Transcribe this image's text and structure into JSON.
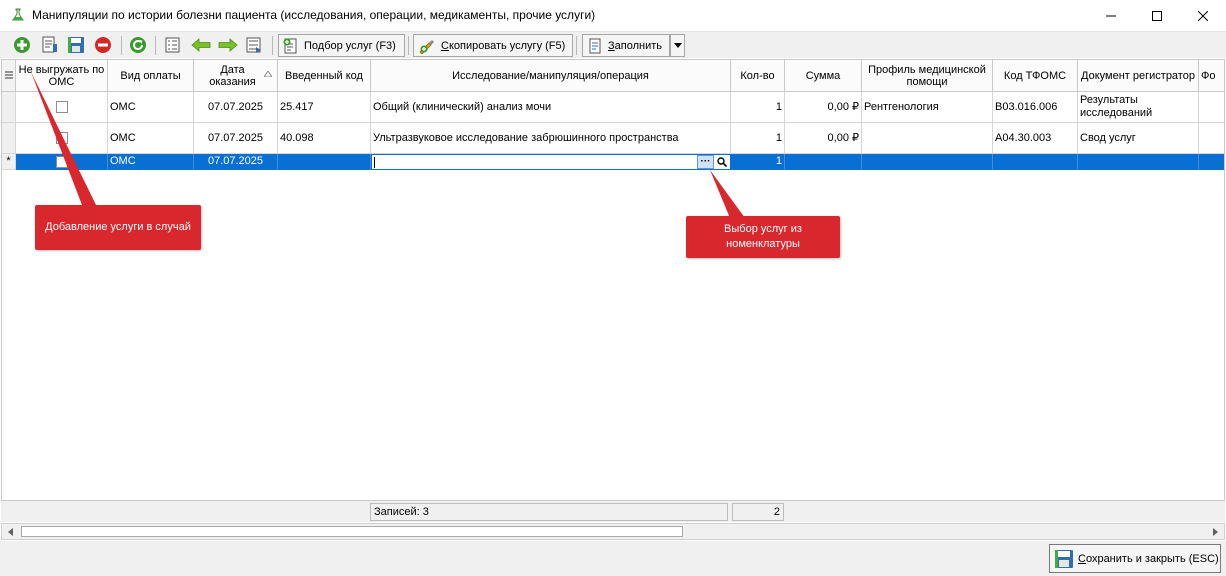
{
  "window": {
    "title": "Манипуляции по истории болезни пациента (исследования, операции, медикаменты, прочие услуги)",
    "minimize_icon": "minimize-icon",
    "maximize_icon": "maximize-icon",
    "close_icon": "close-icon"
  },
  "toolbar": {
    "icons": [
      "add-icon",
      "document-icon",
      "save-icon",
      "delete-icon",
      "refresh-icon",
      "list-icon",
      "arrow-left-icon",
      "arrow-right-icon",
      "list-move-icon"
    ],
    "select_services_label": "Подбор услуг (F3)",
    "copy_service_prefix": "С",
    "copy_service_label": "копировать услугу (F5)",
    "fill_prefix": "З",
    "fill_label": "аполнить",
    "accent_green": "#3a9a2e",
    "accent_red": "#d22828"
  },
  "grid": {
    "columns": [
      "Не выгружать по ОМС",
      "Вид оплаты",
      "Дата оказания",
      "Введенный код",
      "Исследование/манипуляция/операция",
      "Кол-во",
      "Сумма",
      "Профиль медицинской помощи",
      "Код ТФОМС",
      "Документ регистратор",
      "Фо"
    ],
    "rows": [
      {
        "not_upload": "",
        "payment": "ОМС",
        "date": "07.07.2025",
        "entered_code": "25.417",
        "service": "Общий (клинический) анализ мочи",
        "qty": "1",
        "sum": "0,00 ₽",
        "profile": "Рентгенология",
        "tfoms_code": "B03.016.006",
        "document": "Результаты исследований"
      },
      {
        "not_upload": "",
        "payment": "ОМС",
        "date": "07.07.2025",
        "entered_code": "40.098",
        "service": "Ультразвуковое исследование забрюшинного пространства",
        "qty": "1",
        "sum": "0,00 ₽",
        "profile": "",
        "tfoms_code": "A04.30.003",
        "document": "Свод услуг"
      }
    ],
    "new_row": {
      "indicator": "*",
      "payment": "ОМС",
      "date": "07.07.2025",
      "ellipsis": "···",
      "qty": "1"
    },
    "selection_color": "#0a6fd3"
  },
  "status": {
    "records": "Записей: 3",
    "qty_total": "2"
  },
  "footer": {
    "save_close_prefix": "С",
    "save_close_label": "охранить и закрыть (ESC)"
  },
  "callouts": {
    "add_service": "Добавление услуги в случай",
    "select_from_nomenclature": "Выбор услуг из номенклатуры",
    "color": "#d9272e"
  }
}
